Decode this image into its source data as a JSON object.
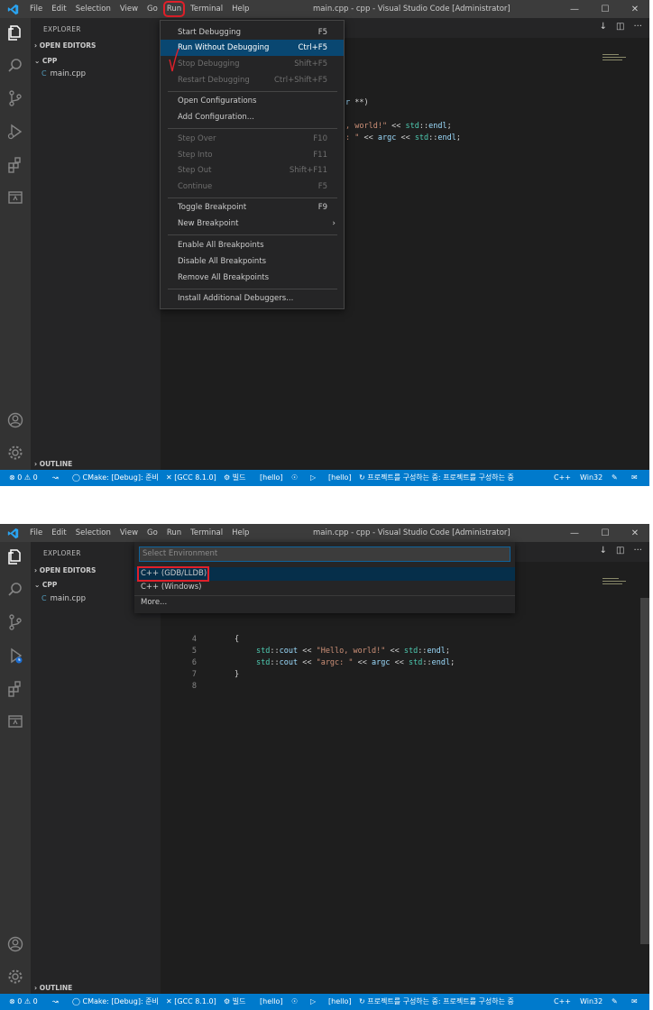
{
  "window": {
    "title": "main.cpp - cpp - Visual Studio Code [Administrator]",
    "menu": [
      "File",
      "Edit",
      "Selection",
      "View",
      "Go",
      "Run",
      "Terminal",
      "Help"
    ]
  },
  "sidebar": {
    "title": "EXPLORER",
    "open_editors": "OPEN EDITORS",
    "folder": "CPP",
    "file_icon": "C",
    "file": "main.cpp",
    "outline": "OUTLINE"
  },
  "run_menu": {
    "items": [
      {
        "label": "Start Debugging",
        "key": "F5"
      },
      {
        "label": "Run Without Debugging",
        "key": "Ctrl+F5"
      },
      {
        "label": "Stop Debugging",
        "key": "Shift+F5"
      },
      {
        "label": "Restart Debugging",
        "key": "Ctrl+Shift+F5"
      },
      {
        "label": "Open Configurations",
        "key": ""
      },
      {
        "label": "Add Configuration...",
        "key": ""
      },
      {
        "label": "Step Over",
        "key": "F10"
      },
      {
        "label": "Step Into",
        "key": "F11"
      },
      {
        "label": "Step Out",
        "key": "Shift+F11"
      },
      {
        "label": "Continue",
        "key": "F5"
      },
      {
        "label": "Toggle Breakpoint",
        "key": "F9"
      },
      {
        "label": "New Breakpoint",
        "key": ""
      },
      {
        "label": "Enable All Breakpoints",
        "key": ""
      },
      {
        "label": "Disable All Breakpoints",
        "key": ""
      },
      {
        "label": "Remove All Breakpoints",
        "key": ""
      },
      {
        "label": "Install Additional Debuggers...",
        "key": ""
      }
    ]
  },
  "editor1": {
    "frag1": "**)",
    "frag2a": ", world!\"",
    "frag2b": " << ",
    "frag2c": "std",
    "frag2d": "::",
    "frag2e": "endl",
    "frag2f": ";",
    "frag3a": ": \"",
    "frag3b": " << ",
    "frag3c": "argc",
    "frag3d": " << ",
    "frag3e": "std",
    "frag3f": "::",
    "frag3g": "endl",
    "frag3h": ";",
    "frag0": "r"
  },
  "editor2": {
    "lines": [
      {
        "n": "4",
        "brace": "{"
      },
      {
        "n": "5",
        "a": "std",
        "b": "::",
        "c": "cout",
        "d": " << ",
        "e": "\"Hello, world!\"",
        "f": " << ",
        "g": "std",
        "h": "::",
        "i": "endl",
        "j": ";"
      },
      {
        "n": "6",
        "a": "std",
        "b": "::",
        "c": "cout",
        "d": " << ",
        "e": "\"argc: \"",
        "f": " << ",
        "k": "argc",
        "l": " << ",
        "g": "std",
        "h": "::",
        "i": "endl",
        "j": ";"
      },
      {
        "n": "7",
        "brace": "}"
      },
      {
        "n": "8"
      }
    ]
  },
  "quick_pick": {
    "placeholder": "Select Environment",
    "options": [
      "C++ (GDB/LLDB)",
      "C++ (Windows)",
      "More..."
    ]
  },
  "statusbar": {
    "errors": "0",
    "warnings": "0",
    "cmake": "CMake: [Debug]: 준비",
    "gcc": "[GCC 8.1.0]",
    "build": "빌드",
    "target1": "[hello]",
    "target2": "[hello]",
    "progress": "프로젝트를 구성하는 중: 프로젝트를 구성하는 중",
    "language": "C++",
    "platform": "Win32"
  },
  "colors": {
    "statusbar": "#007acc",
    "highlight": "#094771",
    "annotation": "#e0202a"
  },
  "icons": [
    "vscode-logo-icon",
    "files-icon",
    "search-icon",
    "source-control-icon",
    "run-debug-icon",
    "extensions-icon",
    "remote-explorer-icon",
    "account-icon",
    "gear-icon"
  ]
}
